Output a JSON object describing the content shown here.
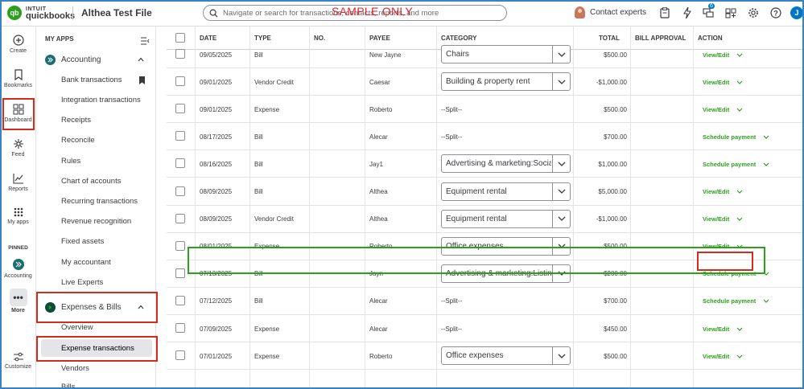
{
  "topbar": {
    "brand_top": "INTUIT",
    "brand_bottom": "quickbooks",
    "company": "Althea Test File",
    "search_placeholder": "Navigate or search for transactions, contacts, reports, and more",
    "watermark": "SAMPLE ONLY",
    "contact_label": "Contact experts",
    "notifications_count": "6",
    "user_initial": "J"
  },
  "rail": {
    "items": [
      {
        "label": "Create",
        "icon": "plus-circle-icon"
      },
      {
        "label": "Bookmarks",
        "icon": "bookmark-icon"
      },
      {
        "label": "Dashboard",
        "icon": "dashboard-grid-icon"
      },
      {
        "label": "Feed",
        "icon": "sparkle-icon"
      },
      {
        "label": "Reports",
        "icon": "line-chart-icon"
      },
      {
        "label": "My apps",
        "icon": "apps-grid-icon"
      }
    ],
    "pinned_label": "PINNED",
    "pinned_accounting": "Accounting",
    "more_label": "More",
    "customize_label": "Customize"
  },
  "nav": {
    "heading": "MY APPS",
    "accounting": {
      "title": "Accounting",
      "links": [
        "Bank transactions",
        "Integration transactions",
        "Receipts",
        "Reconcile",
        "Rules",
        "Chart of accounts",
        "Recurring transactions",
        "Revenue recognition",
        "Fixed assets",
        "My accountant",
        "Live Experts"
      ]
    },
    "expenses": {
      "title": "Expenses & Bills",
      "links": [
        "Overview",
        "Expense transactions",
        "Vendors",
        "Bills"
      ]
    }
  },
  "table": {
    "headers": {
      "date": "DATE",
      "type": "TYPE",
      "no": "NO.",
      "payee": "PAYEE",
      "category": "CATEGORY",
      "total": "TOTAL",
      "bill_approval": "BILL APPROVAL",
      "action": "ACTION"
    },
    "rows": [
      {
        "date": "09/05/2025",
        "type": "Bill",
        "no": "",
        "payee": "New Jayne",
        "category": "Chairs",
        "category_select": true,
        "total": "$500.00",
        "action": "View/Edit"
      },
      {
        "date": "09/01/2025",
        "type": "Vendor Credit",
        "no": "",
        "payee": "Caesar",
        "category": "Building & property rent",
        "category_select": true,
        "total": "-$1,000.00",
        "action": "View/Edit"
      },
      {
        "date": "09/01/2025",
        "type": "Expense",
        "no": "",
        "payee": "Roberto",
        "category": "--Split--",
        "category_select": false,
        "total": "$500.00",
        "action": "View/Edit"
      },
      {
        "date": "08/17/2025",
        "type": "Bill",
        "no": "",
        "payee": "Alecar",
        "category": "--Split--",
        "category_select": false,
        "total": "$700.00",
        "action": "Schedule payment"
      },
      {
        "date": "08/16/2025",
        "type": "Bill",
        "no": "",
        "payee": "Jay1",
        "category": "Advertising & marketing:Social media",
        "category_select": true,
        "total": "$1,000.00",
        "action": "Schedule payment"
      },
      {
        "date": "08/09/2025",
        "type": "Bill",
        "no": "",
        "payee": "Althea",
        "category": "Equipment rental",
        "category_select": true,
        "total": "$5,000.00",
        "action": "View/Edit"
      },
      {
        "date": "08/09/2025",
        "type": "Vendor Credit",
        "no": "",
        "payee": "Althea",
        "category": "Equipment rental",
        "category_select": true,
        "total": "-$1,000.00",
        "action": "View/Edit"
      },
      {
        "date": "08/01/2025",
        "type": "Expense",
        "no": "",
        "payee": "Roberto",
        "category": "Office expenses",
        "category_select": true,
        "total": "$500.00",
        "action": "View/Edit"
      },
      {
        "date": "07/13/2025",
        "type": "Bill",
        "no": "",
        "payee": "Jayn",
        "category": "Advertising & marketing:Listing fees",
        "category_select": true,
        "total": "$200.00",
        "action": "Schedule payment"
      },
      {
        "date": "07/12/2025",
        "type": "Bill",
        "no": "",
        "payee": "Alecar",
        "category": "--Split--",
        "category_select": false,
        "total": "$700.00",
        "action": "Schedule payment"
      },
      {
        "date": "07/09/2025",
        "type": "Expense",
        "no": "",
        "payee": "Alecar",
        "category": "--Split--",
        "category_select": false,
        "total": "$450.00",
        "action": "View/Edit"
      },
      {
        "date": "07/01/2025",
        "type": "Expense",
        "no": "",
        "payee": "Roberto",
        "category": "Office expenses",
        "category_select": true,
        "total": "$500.00",
        "action": "View/Edit"
      }
    ]
  },
  "colors": {
    "brand_green": "#2ca01c",
    "annotation_red": "#d52b1e",
    "annotation_green": "#2ca01c",
    "accent_blue": "#0077c5"
  }
}
